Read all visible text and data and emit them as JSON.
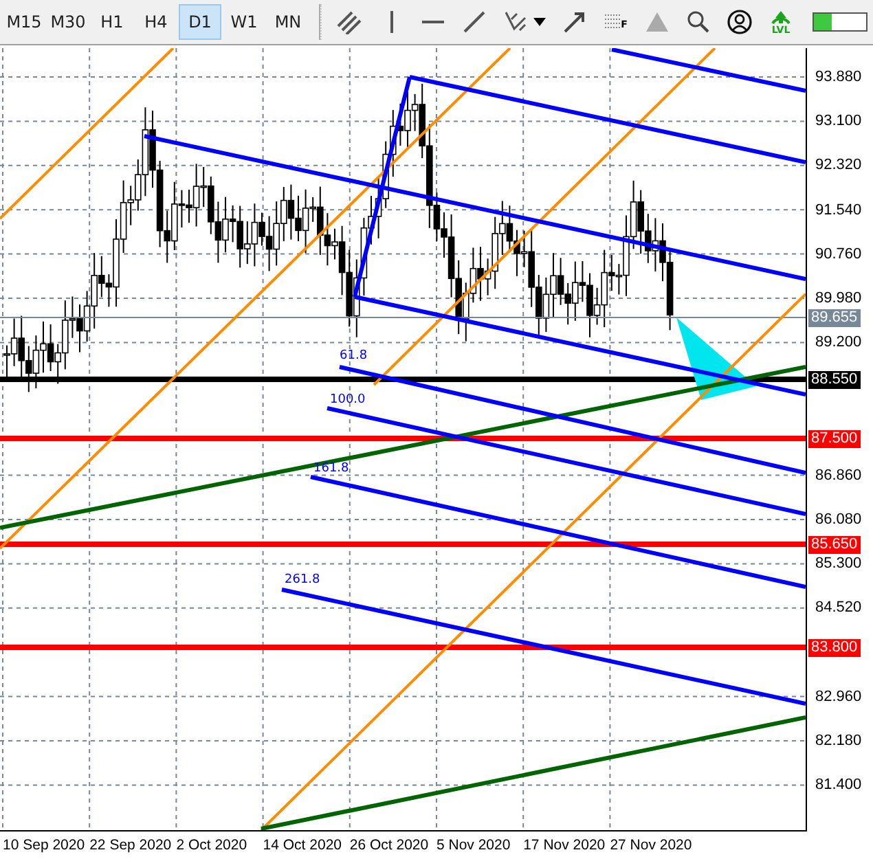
{
  "toolbar": {
    "timeframes": [
      {
        "label": "M15",
        "selected": false
      },
      {
        "label": "M30",
        "selected": false
      },
      {
        "label": "H1",
        "selected": false
      },
      {
        "label": "H4",
        "selected": false
      },
      {
        "label": "D1",
        "selected": true
      },
      {
        "label": "W1",
        "selected": false
      },
      {
        "label": "MN",
        "selected": false
      }
    ],
    "tools": [
      {
        "kind": "channel"
      },
      {
        "kind": "vline"
      },
      {
        "kind": "hline"
      },
      {
        "kind": "trend"
      },
      {
        "kind": "fibo"
      },
      {
        "kind": "caret"
      },
      {
        "kind": "arrow"
      },
      {
        "kind": "grid",
        "text": "F"
      },
      {
        "kind": "triangle"
      },
      {
        "kind": "search"
      },
      {
        "kind": "user"
      },
      {
        "kind": "lvl",
        "text": "LVL"
      }
    ],
    "meter": {
      "level": 0.33
    }
  },
  "chart": {
    "fib_labels": [
      "61.8",
      "100.0",
      "161.8",
      "261.8"
    ]
  },
  "price_axis": {
    "ticks": [
      "93.880",
      "93.100",
      "92.320",
      "91.540",
      "90.760",
      "89.980",
      "89.200",
      "86.860",
      "86.080",
      "85.300",
      "84.520",
      "82.960",
      "82.180",
      "81.400"
    ],
    "tags": [
      {
        "text": "89.655",
        "color": "#778899",
        "kind": "price"
      },
      {
        "text": "88.550",
        "color": "#000000",
        "kind": "level"
      },
      {
        "text": "87.500",
        "color": "#ff0000",
        "kind": "level"
      },
      {
        "text": "85.650",
        "color": "#ff0000",
        "kind": "level"
      },
      {
        "text": "83.800",
        "color": "#ff0000",
        "kind": "level"
      }
    ]
  },
  "time_axis": {
    "labels": [
      "10 Sep 2020",
      "22 Sep 2020",
      "2 Oct 2020",
      "14 Oct 2020",
      "26 Oct 2020",
      "5 Nov 2020",
      "17 Nov 2020",
      "27 Nov 2020"
    ]
  }
}
